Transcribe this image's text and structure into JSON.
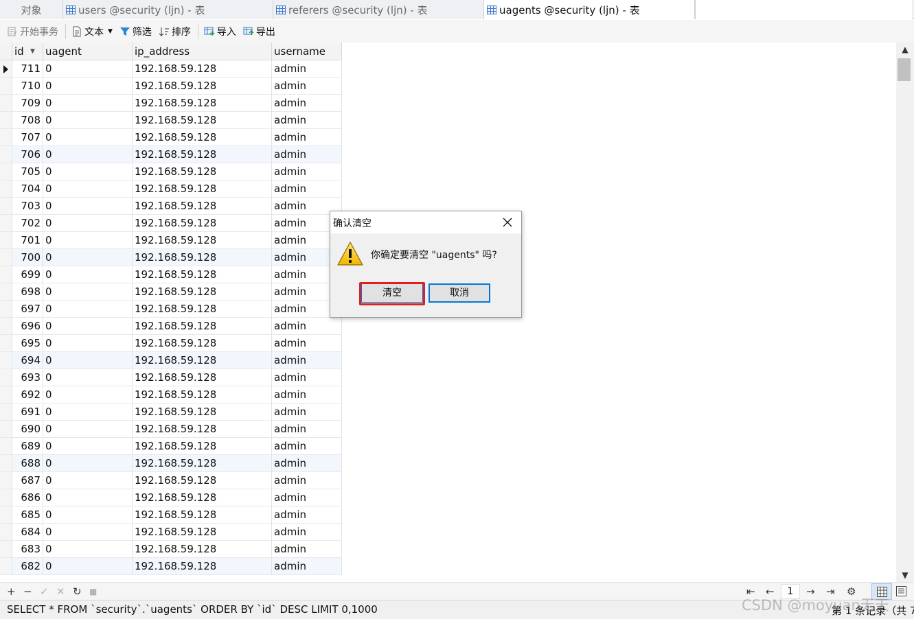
{
  "tabs": [
    {
      "label": "对象",
      "active": false,
      "icon": "none"
    },
    {
      "label": "users @security (ljn) - 表",
      "active": false,
      "icon": "table-icon"
    },
    {
      "label": "referers @security (ljn) - 表",
      "active": false,
      "icon": "table-icon"
    },
    {
      "label": "uagents @security (ljn) - 表",
      "active": true,
      "icon": "table-icon"
    }
  ],
  "toolbar": {
    "begin_transaction": "开始事务",
    "text": "文本",
    "filter": "筛选",
    "sort": "排序",
    "import": "导入",
    "export": "导出"
  },
  "table": {
    "columns": [
      "id",
      "uagent",
      "ip_address",
      "username"
    ],
    "rows": [
      [
        "711",
        "0",
        "192.168.59.128",
        "admin"
      ],
      [
        "710",
        "0",
        "192.168.59.128",
        "admin"
      ],
      [
        "709",
        "0",
        "192.168.59.128",
        "admin"
      ],
      [
        "708",
        "0",
        "192.168.59.128",
        "admin"
      ],
      [
        "707",
        "0",
        "192.168.59.128",
        "admin"
      ],
      [
        "706",
        "0",
        "192.168.59.128",
        "admin"
      ],
      [
        "705",
        "0",
        "192.168.59.128",
        "admin"
      ],
      [
        "704",
        "0",
        "192.168.59.128",
        "admin"
      ],
      [
        "703",
        "0",
        "192.168.59.128",
        "admin"
      ],
      [
        "702",
        "0",
        "192.168.59.128",
        "admin"
      ],
      [
        "701",
        "0",
        "192.168.59.128",
        "admin"
      ],
      [
        "700",
        "0",
        "192.168.59.128",
        "admin"
      ],
      [
        "699",
        "0",
        "192.168.59.128",
        "admin"
      ],
      [
        "698",
        "0",
        "192.168.59.128",
        "admin"
      ],
      [
        "697",
        "0",
        "192.168.59.128",
        "admin"
      ],
      [
        "696",
        "0",
        "192.168.59.128",
        "admin"
      ],
      [
        "695",
        "0",
        "192.168.59.128",
        "admin"
      ],
      [
        "694",
        "0",
        "192.168.59.128",
        "admin"
      ],
      [
        "693",
        "0",
        "192.168.59.128",
        "admin"
      ],
      [
        "692",
        "0",
        "192.168.59.128",
        "admin"
      ],
      [
        "691",
        "0",
        "192.168.59.128",
        "admin"
      ],
      [
        "690",
        "0",
        "192.168.59.128",
        "admin"
      ],
      [
        "689",
        "0",
        "192.168.59.128",
        "admin"
      ],
      [
        "688",
        "0",
        "192.168.59.128",
        "admin"
      ],
      [
        "687",
        "0",
        "192.168.59.128",
        "admin"
      ],
      [
        "686",
        "0",
        "192.168.59.128",
        "admin"
      ],
      [
        "685",
        "0",
        "192.168.59.128",
        "admin"
      ],
      [
        "684",
        "0",
        "192.168.59.128",
        "admin"
      ],
      [
        "683",
        "0",
        "192.168.59.128",
        "admin"
      ],
      [
        "682",
        "0",
        "192.168.59.128",
        "admin"
      ]
    ]
  },
  "navbar": {
    "add": "+",
    "remove": "−",
    "apply": "✓",
    "discard": "✕",
    "refresh": "↻",
    "stop": "■",
    "first": "⇤",
    "prev": "←",
    "page": "1",
    "next": "→",
    "last": "⇥",
    "settings": "⚙"
  },
  "status": {
    "sql": "SELECT * FROM `security`.`uagents` ORDER BY `id` DESC LIMIT 0,1000",
    "record_count": "第 1 条记录（共 7",
    "watermark": "CSDN @moyuan无天"
  },
  "dialog": {
    "title": "确认清空",
    "message": "你确定要清空 \"uagents\" 吗?",
    "confirm_label": "清空",
    "cancel_label": "取消"
  },
  "colors": {
    "accent": "#0078d7",
    "highlight": "#e02020",
    "alt_row": "#f2f7fd"
  }
}
